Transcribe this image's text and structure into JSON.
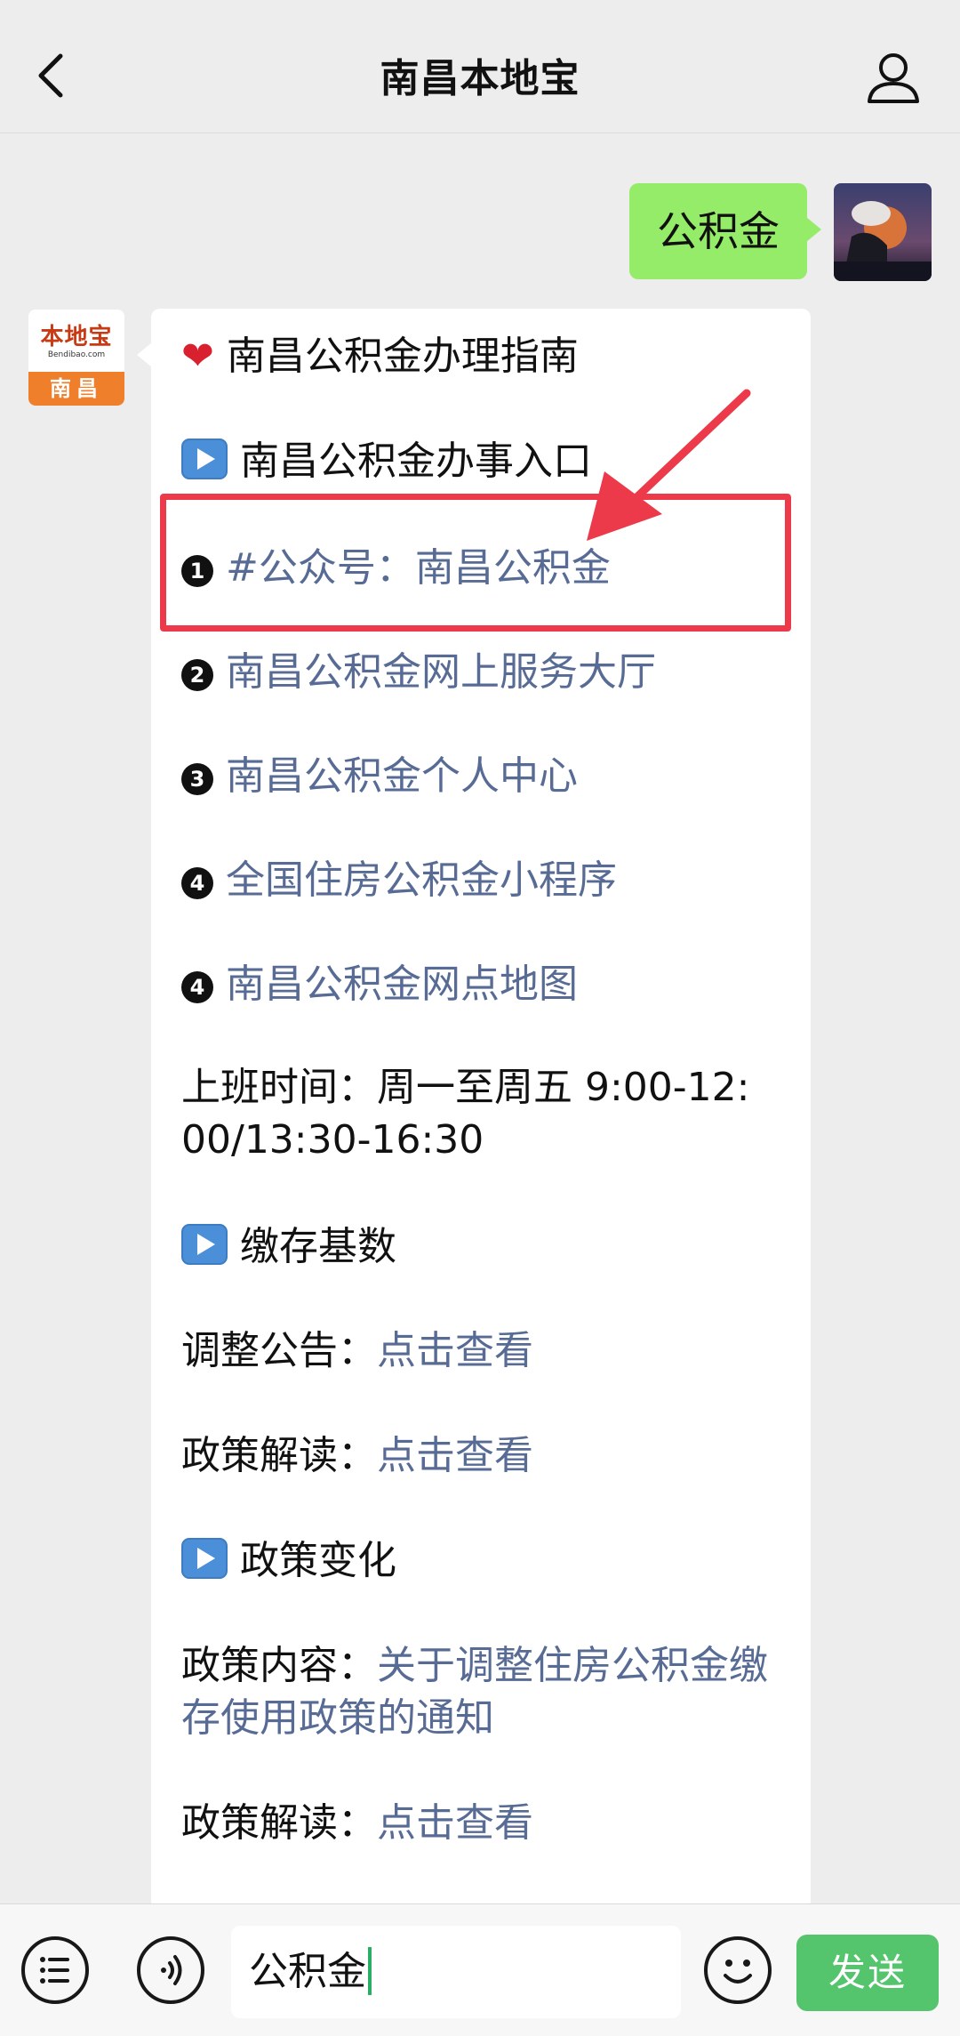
{
  "header": {
    "title": "南昌本地宝"
  },
  "outgoing": {
    "text": "公积金"
  },
  "brand_avatar": {
    "logo_text": "本地宝",
    "url_text": "Bendibao.com",
    "city": "南昌"
  },
  "message": {
    "title": "南昌公积金办理指南",
    "section_entry": "南昌公积金办事入口",
    "items": [
      {
        "num": "1",
        "text": "#公众号：南昌公积金"
      },
      {
        "num": "2",
        "text": "南昌公积金网上服务大厅"
      },
      {
        "num": "3",
        "text": "南昌公积金个人中心"
      },
      {
        "num": "4",
        "text": "全国住房公积金小程序"
      },
      {
        "num": "4",
        "text": "南昌公积金网点地图"
      }
    ],
    "hours_line1": "上班时间：周一至周五 9:00-12:",
    "hours_line2": "00/13:30-16:30",
    "section_base": "缴存基数",
    "adjust_label": "调整公告：",
    "adjust_link": "点击查看",
    "interpret_label": "政策解读：",
    "interpret_link": "点击查看",
    "section_policy": "政策变化",
    "policy_label": "政策内容：",
    "policy_link_line1": "关于调整住房公积金缴",
    "policy_link_line2": "存使用政策的通知",
    "interpret2_label": "政策解读：",
    "interpret2_link": "点击查看"
  },
  "input": {
    "value": "公积金"
  },
  "send_label": "发送",
  "colors": {
    "outgoing_bubble": "#95ec69",
    "link": "#576b95",
    "highlight": "#ec3a4b",
    "send_button": "#54c46d"
  }
}
